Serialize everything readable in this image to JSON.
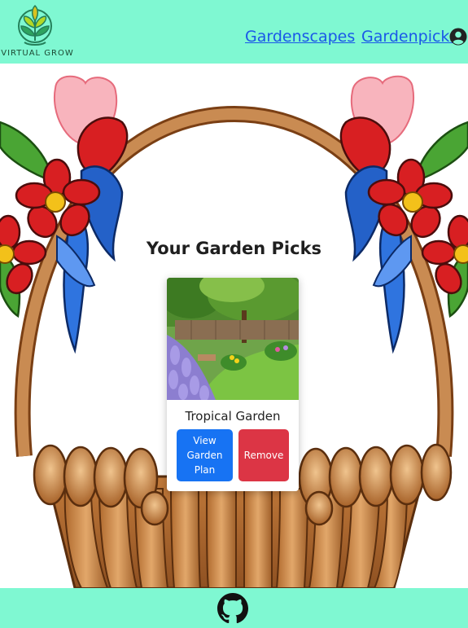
{
  "brand": {
    "logo_text": "VIRTUAL GROW"
  },
  "nav": {
    "links": [
      {
        "label": "Gardenscapes"
      },
      {
        "label": "Gardenpicks"
      }
    ]
  },
  "icons": {
    "user": "user-circle-icon",
    "github": "github-icon",
    "logo": "sprout-logo-icon"
  },
  "main": {
    "title": "Your Garden Picks",
    "cards": [
      {
        "name": "Tropical Garden",
        "view_label": "View Garden Plan",
        "remove_label": "Remove"
      }
    ]
  },
  "colors": {
    "header_bg": "#7ff8d2",
    "footer_bg": "#7ff8d2",
    "link": "#1a58e8",
    "primary_button": "#1773f3",
    "danger_button": "#dc3545",
    "basket": "#c98b52"
  }
}
